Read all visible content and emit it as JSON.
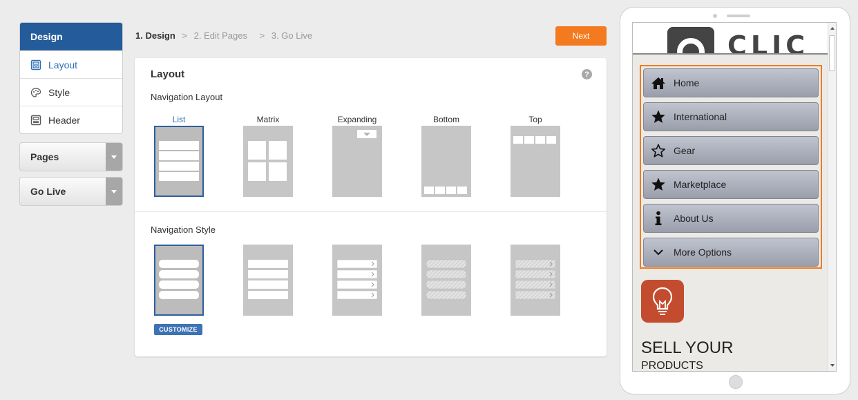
{
  "sidebar": {
    "design_title": "Design",
    "design_items": [
      {
        "label": "Layout",
        "icon": "layout-icon",
        "active": true
      },
      {
        "label": "Style",
        "icon": "palette-icon",
        "active": false
      },
      {
        "label": "Header",
        "icon": "header-icon",
        "active": false
      }
    ],
    "pages_label": "Pages",
    "golive_label": "Go Live"
  },
  "breadcrumb": {
    "step1": "1. Design",
    "step2": "2. Edit Pages",
    "step3": "3. Go Live",
    "separator": ">"
  },
  "next_label": "Next",
  "main": {
    "title": "Layout",
    "help": "?",
    "nav_layout_title": "Navigation Layout",
    "nav_layout_options": [
      "List",
      "Matrix",
      "Expanding",
      "Bottom",
      "Top"
    ],
    "selected_layout": "List",
    "nav_style_title": "Navigation Style",
    "selected_style_index": 0,
    "customize_label": "CUSTOMIZE"
  },
  "preview": {
    "logo_text": "CLIC",
    "nav_items": [
      {
        "label": "Home",
        "icon": "home-icon"
      },
      {
        "label": "International",
        "icon": "star-filled-icon"
      },
      {
        "label": "Gear",
        "icon": "star-outline-icon"
      },
      {
        "label": "Marketplace",
        "icon": "star-filled-icon"
      },
      {
        "label": "About Us",
        "icon": "info-icon"
      },
      {
        "label": "More Options",
        "icon": "chevron-down-icon"
      }
    ],
    "promo_title": "SELL YOUR",
    "promo_subtitle": "PRODUCTS"
  },
  "colors": {
    "accent_blue": "#245b9a",
    "next_orange": "#f47a20",
    "nav_frame_orange": "#f07b1f",
    "promo_red": "#c44c2e"
  }
}
